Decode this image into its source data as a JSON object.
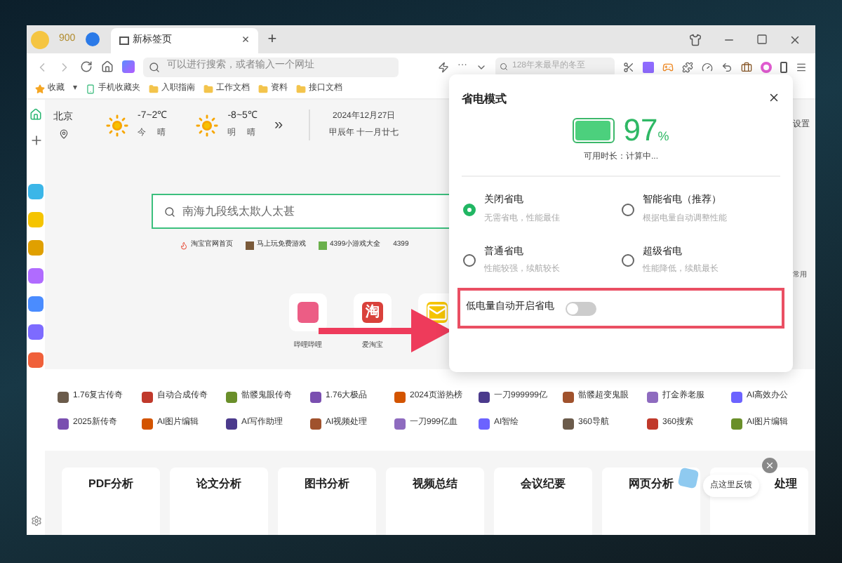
{
  "tab_bar": {
    "coins": "900",
    "tabs": [
      {
        "title": "新标签页",
        "selected": true
      }
    ],
    "close": "×",
    "new_tab": "+"
  },
  "address_bar": {
    "placeholder": "可以进行搜索，或者输入一个网址",
    "more": "···",
    "side_search_placeholder": "128年来最早的冬至"
  },
  "bookmarks": [
    {
      "kind": "star",
      "label": "收藏"
    },
    {
      "kind": "caret",
      "label": "▾"
    },
    {
      "kind": "phone",
      "label": "手机收藏夹"
    },
    {
      "kind": "folder",
      "label": "入职指南"
    },
    {
      "kind": "folder",
      "label": "工作文档"
    },
    {
      "kind": "folder",
      "label": "资料"
    },
    {
      "kind": "folder",
      "label": "接口文档"
    }
  ],
  "weather": {
    "city": "北京",
    "days": [
      {
        "temp": "-7~2℃",
        "day": "今",
        "condition": "晴"
      },
      {
        "temp": "-8~5℃",
        "day": "明",
        "condition": "晴"
      }
    ],
    "more": "»",
    "date": "2024年12月27日",
    "lunar": "甲辰年 十一月廿七",
    "settings": "设置"
  },
  "search": {
    "placeholder": "南海九段线太欺人太甚",
    "hot_links": [
      {
        "kind": "fire",
        "label": "淘宝官网首页"
      },
      {
        "kind": "game",
        "label": "马上玩免费游戏"
      },
      {
        "kind": "game4399",
        "label": "4399小游戏大全"
      },
      {
        "kind": "none",
        "label": "4399"
      }
    ]
  },
  "side_label": "常用",
  "apps": [
    {
      "kind": "bilibili",
      "label": "哔哩哔哩"
    },
    {
      "kind": "taobao",
      "glyph": "淘",
      "label": "爱淘宝"
    },
    {
      "kind": "mail"
    }
  ],
  "game_links": [
    [
      {
        "label": "1.76复古传奇"
      },
      {
        "label": "自动合成传奇"
      },
      {
        "label": "骷髅鬼眼传奇"
      },
      {
        "label": "1.76大极品"
      },
      {
        "label": "2024页游热榜"
      },
      {
        "label": "一刀999999亿"
      },
      {
        "label": "骷髅超变鬼眼"
      },
      {
        "label": "打金养老服"
      },
      {
        "label": "AI高效办公"
      }
    ],
    [
      {
        "label": "2025新传奇"
      },
      {
        "label": "AI图片编辑"
      },
      {
        "label": "AI写作助理"
      },
      {
        "label": "AI视频处理"
      },
      {
        "label": "一刀999亿血"
      },
      {
        "label": "AI智绘"
      },
      {
        "label": "360导航"
      },
      {
        "label": "360搜索"
      },
      {
        "label": "AI图片编辑"
      }
    ]
  ],
  "tools": [
    "PDF分析",
    "论文分析",
    "图书分析",
    "视频总结",
    "会议纪要",
    "网页分析",
    "处理"
  ],
  "feedback": {
    "label": "点这里反馈"
  },
  "power_popup": {
    "title": "省电模式",
    "level": 0.97,
    "percent": "97",
    "percent_sign": "%",
    "remaining": "可用时长：计算中...",
    "options": [
      {
        "title": "关闭省电",
        "desc": "无需省电，性能最佳",
        "selected": true
      },
      {
        "title": "智能省电（推荐）",
        "desc": "根据电量自动调整性能",
        "selected": false
      },
      {
        "title": "普通省电",
        "desc": "性能较强，续航较长",
        "selected": false
      },
      {
        "title": "超级省电",
        "desc": "性能降低，续航最长",
        "selected": false
      }
    ],
    "auto_switch": {
      "label": "低电量自动开启省电",
      "on": false
    }
  }
}
